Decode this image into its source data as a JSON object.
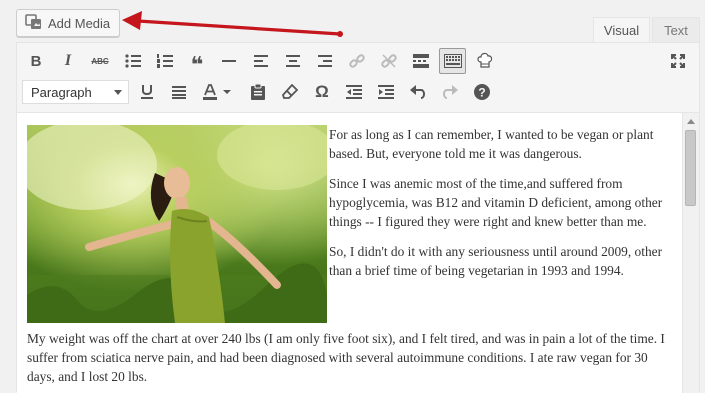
{
  "add_media": {
    "label": "Add Media",
    "icon": "media-icon"
  },
  "tabs": [
    {
      "label": "Visual",
      "active": true
    },
    {
      "label": "Text",
      "active": false
    }
  ],
  "toolbar": {
    "row1": [
      {
        "name": "bold-button",
        "glyph": "B"
      },
      {
        "name": "italic-button",
        "glyph": "I"
      },
      {
        "name": "strikethrough-button",
        "glyph": "ABC"
      },
      {
        "name": "bulleted-list-button",
        "glyph": "bullets"
      },
      {
        "name": "numbered-list-button",
        "glyph": "numbers"
      },
      {
        "name": "blockquote-button",
        "glyph": "❝"
      },
      {
        "name": "horizontal-line-button",
        "glyph": "—"
      },
      {
        "name": "align-left-button",
        "glyph": "left"
      },
      {
        "name": "align-center-button",
        "glyph": "center"
      },
      {
        "name": "align-right-button",
        "glyph": "right"
      },
      {
        "name": "insert-link-button",
        "glyph": "link"
      },
      {
        "name": "remove-link-button",
        "glyph": "unlink"
      },
      {
        "name": "read-more-button",
        "glyph": "more"
      },
      {
        "name": "toolbar-toggle-button",
        "glyph": "kitchen"
      },
      {
        "name": "chef-hat-button",
        "glyph": "chef"
      },
      {
        "name": "fullscreen-button",
        "glyph": "fullscreen"
      }
    ],
    "format_select": {
      "value": "Paragraph"
    },
    "row2": [
      {
        "name": "underline-button"
      },
      {
        "name": "justify-button"
      },
      {
        "name": "text-color-button"
      },
      {
        "name": "paste-as-text-button"
      },
      {
        "name": "clear-formatting-button"
      },
      {
        "name": "special-character-button",
        "glyph": "Ω"
      },
      {
        "name": "decrease-indent-button"
      },
      {
        "name": "increase-indent-button"
      },
      {
        "name": "undo-button"
      },
      {
        "name": "redo-button"
      },
      {
        "name": "help-button",
        "glyph": "?"
      }
    ]
  },
  "content": {
    "paragraphs": [
      "For as long as I can remember, I wanted to be vegan or plant based. But, everyone told me it was dangerous.",
      "Since I was anemic most of the time,and suffered from hypoglycemia, was B12 and vitamin D deficient, among other things --  I figured they were right and knew better than me.",
      "So, I didn't do it with any seriousness until around 2009, other than a brief time of being vegetarian in 1993 and 1994.",
      "My weight was off the chart at over 240 lbs (I am only five foot six), and I felt tired, and was in pain a lot of the time. I suffer from sciatica nerve pain, and had been diagnosed with several autoimmune conditions. I ate raw vegan for 30 days, and I lost 20 lbs."
    ]
  },
  "colors": {
    "arrow": "#c4161c",
    "toolbar_icon": "#555555",
    "disabled_icon": "#bbbbbb"
  }
}
